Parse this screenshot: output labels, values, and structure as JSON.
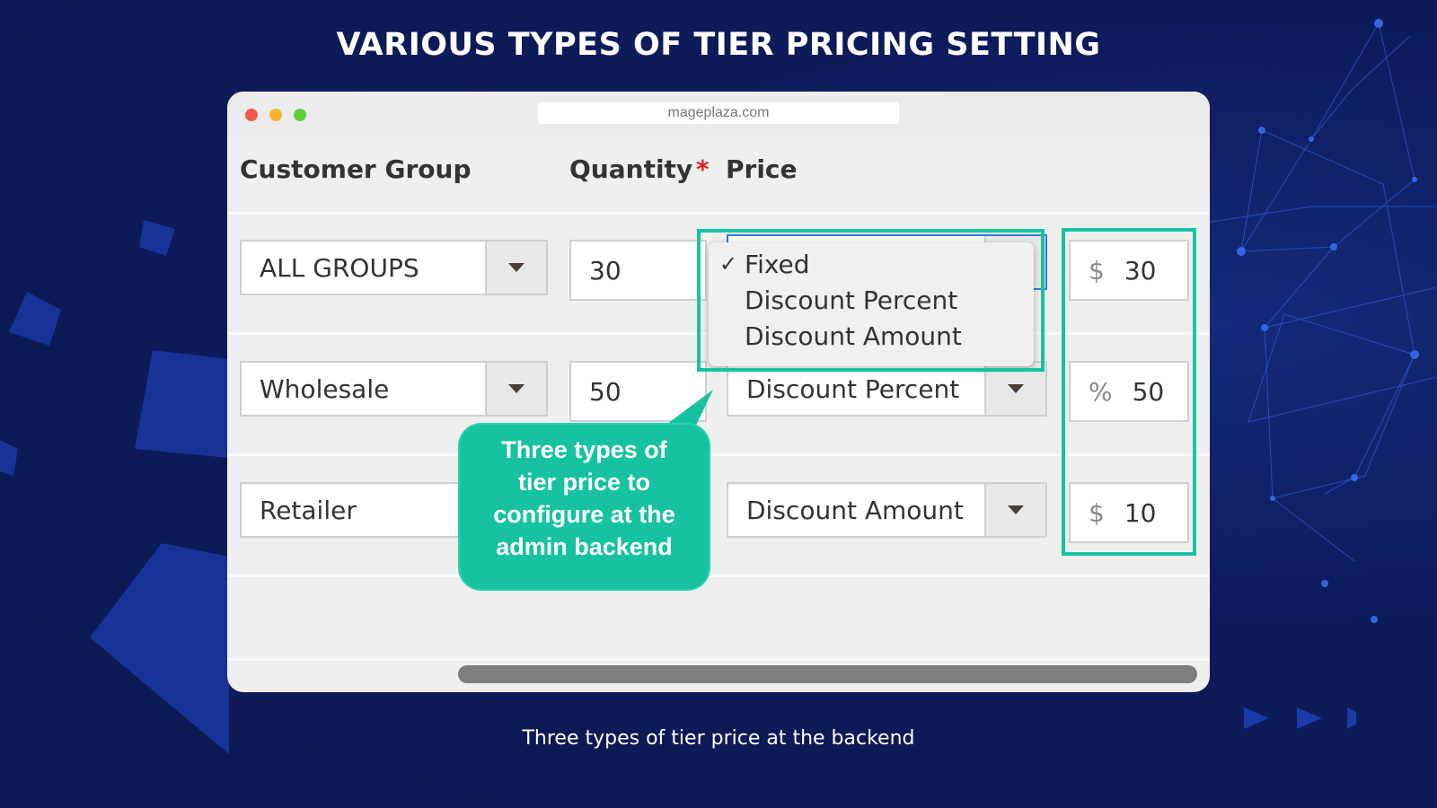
{
  "title": "VARIOUS TYPES OF TIER PRICING SETTING",
  "caption": "Three types of tier price at the backend",
  "browser": {
    "address": "mageplaza.com"
  },
  "columns": {
    "customer_group": "Customer Group",
    "quantity": "Quantity",
    "required": "*",
    "price": "Price"
  },
  "rows": [
    {
      "group": "ALL GROUPS",
      "qty": "30",
      "price_type": "Fixed",
      "symbol": "$",
      "amount": "30"
    },
    {
      "group": "Wholesale",
      "qty": "50",
      "price_type": "Discount Percent",
      "symbol": "%",
      "amount": "50"
    },
    {
      "group": "Retailer",
      "qty": "",
      "price_type": "Discount Amount",
      "symbol": "$",
      "amount": "10"
    }
  ],
  "dropdown": {
    "check": "✓",
    "options": [
      "Fixed",
      "Discount Percent",
      "Discount Amount"
    ],
    "selected": "Fixed"
  },
  "callout": {
    "lines": [
      "Three types of",
      "tier price to",
      "configure at the",
      "admin backend"
    ]
  },
  "colors": {
    "accent": "#17c3a2",
    "background": "#0c1a52",
    "required": "#e02020"
  }
}
